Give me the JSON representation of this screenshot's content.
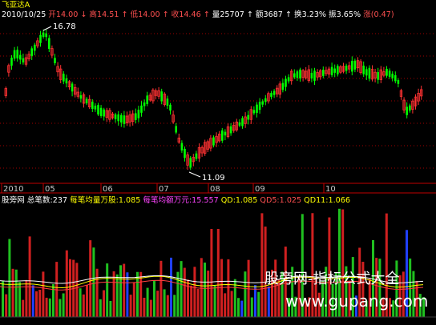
{
  "header": {
    "stock_name": "飞亚达A",
    "date": "2010/10/25",
    "open_label": "开",
    "open": "14.00",
    "high_label": "高",
    "high": "14.51",
    "low_label": "低",
    "low": "14.00",
    "close_label": "收",
    "close": "14.46",
    "volume_label": "量",
    "volume": "25707",
    "amount_label": "额",
    "amount": "3687",
    "turnover_label": "换",
    "turnover": "3.23%",
    "amplitude_label": "振",
    "amplitude": "3.65%",
    "change_label": "涨",
    "change": "(0.47)",
    "arrow_down": "↓",
    "arrow_up": "↑"
  },
  "price_chart": {
    "high_annotation": "16.78",
    "low_annotation": "11.09",
    "x_ticks": [
      "2010",
      "05",
      "06",
      "07",
      "08",
      "09",
      "10"
    ],
    "colors": {
      "up": "#ff3232",
      "down": "#00ff00",
      "grid": "#a00000",
      "axis": "#c00000"
    }
  },
  "indicator": {
    "name": "股旁网",
    "total_trades_label": "总笔数:",
    "total_trades": "237",
    "avg_volume_label": "每笔均量万股:",
    "avg_volume": "1.085",
    "avg_amount_label": "每笔均额万元:",
    "avg_amount": "15.557",
    "qd_label": "QD:",
    "qd": "1.085",
    "qd5_label": "QD5:",
    "qd5": "1.025",
    "qd11_label": "QD11:",
    "qd11": "1.066"
  },
  "watermark": {
    "line1": "股旁网-指标公式大全",
    "line2": "www.gupang.com"
  }
}
